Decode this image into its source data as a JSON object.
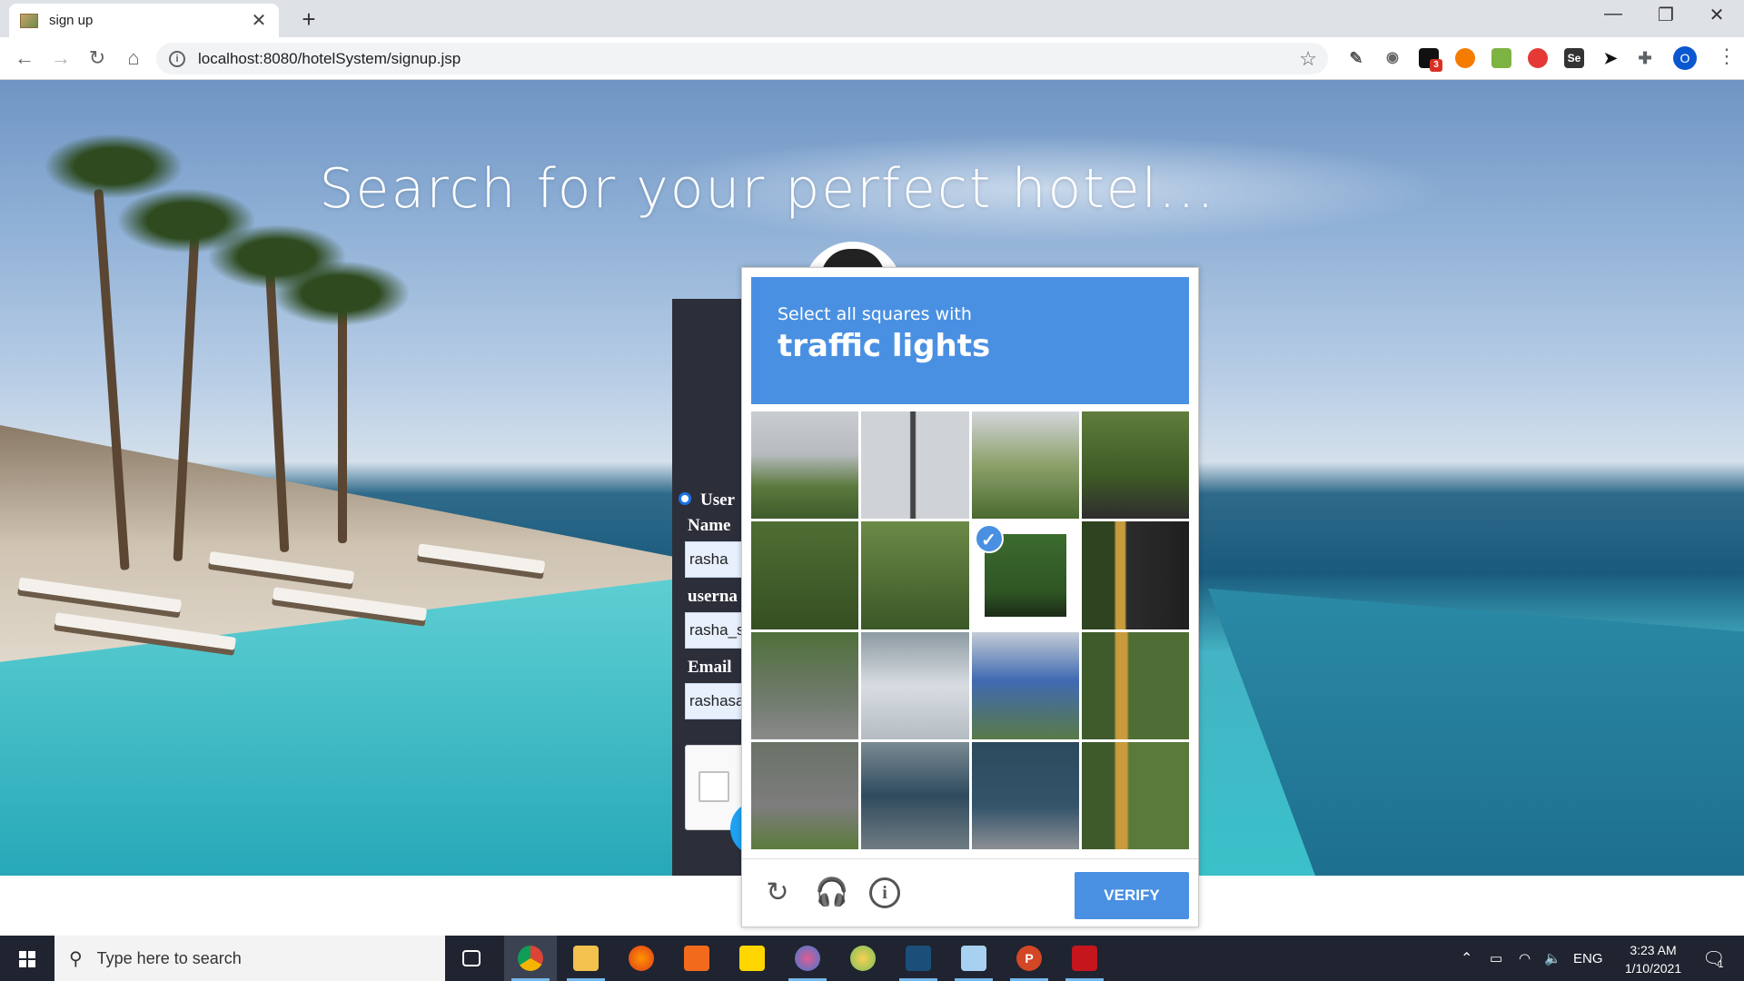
{
  "browser": {
    "tab_title": "sign up",
    "new_tab_symbol": "+",
    "url": "localhost:8080/hotelSystem/signup.jsp",
    "profile_initial": "O",
    "extension_badge": "3"
  },
  "page": {
    "hero_title": "Search for your perfect hotel...",
    "form": {
      "radio_label": "User",
      "name_label": "Name",
      "name_value": "rasha",
      "username_label": "userna",
      "username_value": "rasha_s",
      "email_label": "Email",
      "email_value": "rashasa"
    }
  },
  "captcha": {
    "prompt": "Select all squares with",
    "target": "traffic lights",
    "verify_label": "VERIFY",
    "selected_tiles": [
      6
    ]
  },
  "taskbar": {
    "search_placeholder": "Type here to search",
    "language": "ENG",
    "time": "3:23 AM",
    "date": "1/10/2021",
    "notification_count": "1"
  },
  "colors": {
    "captcha_blue": "#4a90e2",
    "form_panel": "#2c2f3a",
    "taskbar": "#1f2430"
  }
}
